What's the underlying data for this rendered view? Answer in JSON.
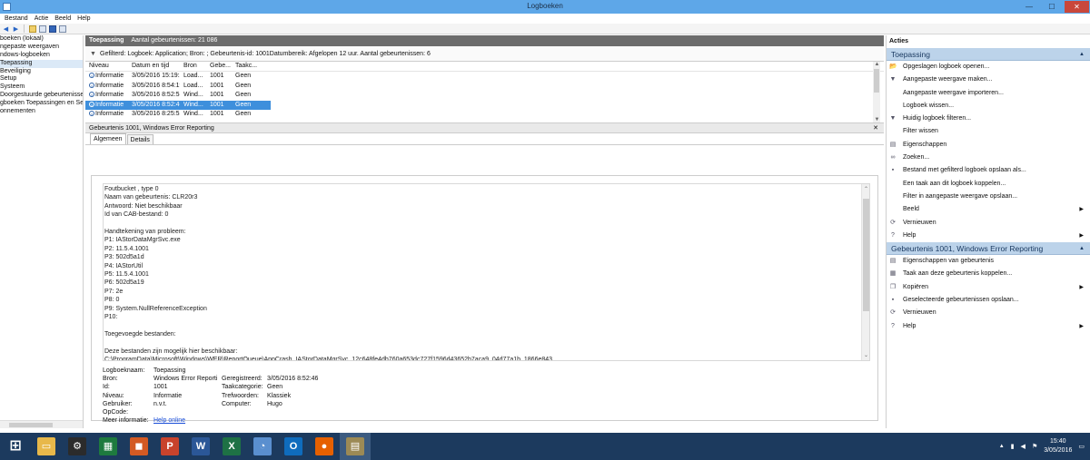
{
  "window": {
    "title": "Logboeken",
    "minimize": "—",
    "maximize": "☐",
    "close": "✕"
  },
  "menu": [
    "Bestand",
    "Actie",
    "Beeld",
    "Help"
  ],
  "tree": {
    "items": [
      {
        "label": "boeken (lokaal)",
        "selected": false
      },
      {
        "label": "ngepaste weergaven",
        "selected": false
      },
      {
        "label": "ndows-logboeken",
        "selected": false
      },
      {
        "label": "Toepassing",
        "selected": true
      },
      {
        "label": "Beveiliging",
        "selected": false
      },
      {
        "label": "Setup",
        "selected": false
      },
      {
        "label": "Systeem",
        "selected": false
      },
      {
        "label": "Doorgestuurde gebeurtenisse",
        "selected": false
      },
      {
        "label": "gboeken Toepassingen en Se",
        "selected": false
      },
      {
        "label": "onnementen",
        "selected": false
      }
    ]
  },
  "center": {
    "header_title": "Toepassing",
    "header_count": "Aantal gebeurtenissen: 21 086",
    "filter_text": "Gefilterd: Logboek: Application; Bron: ; Gebeurtenis-id: 1001Datumbereik: Afgelopen 12 uur. Aantal gebeurtenissen: 6",
    "columns": [
      "Niveau",
      "Datum en tijd",
      "Bron",
      "Gebe...",
      "Taakc..."
    ],
    "rows": [
      {
        "level": "Informatie",
        "datetime": "3/05/2016 15:19:24",
        "source": "Load...",
        "id": "1001",
        "task": "Geen",
        "selected": false
      },
      {
        "level": "Informatie",
        "datetime": "3/05/2016 8:54:19",
        "source": "Load...",
        "id": "1001",
        "task": "Geen",
        "selected": false
      },
      {
        "level": "Informatie",
        "datetime": "3/05/2016 8:52:53",
        "source": "Wind...",
        "id": "1001",
        "task": "Geen",
        "selected": false
      },
      {
        "level": "Informatie",
        "datetime": "3/05/2016 8:52:46",
        "source": "Wind...",
        "id": "1001",
        "task": "Geen",
        "selected": true
      },
      {
        "level": "Informatie",
        "datetime": "3/05/2016 8:25:52",
        "source": "Wind...",
        "id": "1001",
        "task": "Geen",
        "selected": false
      }
    ],
    "detail_title": "Gebeurtenis 1001, Windows Error Reporting",
    "tabs": [
      "Algemeen",
      "Details"
    ],
    "message_lines": [
      "Foutbucket , type 0",
      "Naam van gebeurtenis: CLR20r3",
      "Antwoord: Niet beschikbaar",
      "Id van CAB-bestand: 0",
      "",
      "Handtekening van probleem:",
      "P1: IAStorDataMgrSvc.exe",
      "P2: 11.5.4.1001",
      "P3: 502d5a1d",
      "P4: IAStorUtil",
      "P5: 11.5.4.1001",
      "P6: 502d5a19",
      "P7: 2e",
      "P8: 0",
      "P9: System.NullReferenceException",
      "P10:",
      "",
      "Toegevoegde bestanden:",
      "",
      "Deze bestanden zijn mogelijk hier beschikbaar:",
      "C:\\ProgramData\\Microsoft\\Windows\\WER\\ReportQueue\\AppCrash_IAStorDataMgrSvc_12c648fe4db760a653dc727f1596d43652b7aca9_04d77a1b_1866e843"
    ],
    "props": {
      "logname_label": "Logboeknaam:",
      "logname": "Toepassing",
      "source_label": "Bron:",
      "source": "Windows Error Reporti",
      "recorded_label": "Geregistreerd:",
      "recorded": "3/05/2016 8:52:46",
      "id_label": "Id:",
      "id": "1001",
      "taskcat_label": "Taakcategorie:",
      "taskcat": "Geen",
      "level_label": "Niveau:",
      "level": "Informatie",
      "keywords_label": "Trefwoorden:",
      "keywords": "Klassiek",
      "user_label": "Gebruiker:",
      "user": "n.v.t.",
      "computer_label": "Computer:",
      "computer": "Hugo",
      "opcode_label": "OpCode:",
      "moreinfo_label": "Meer informatie:",
      "moreinfo_link": "Help online"
    }
  },
  "actions": {
    "title": "Acties",
    "section1_title": "Toepassing",
    "section1_items": [
      {
        "label": "Opgeslagen logboek openen...",
        "icon": "folder-icon",
        "glyph": "📂",
        "submenu": false
      },
      {
        "label": "Aangepaste weergave maken...",
        "icon": "filter-icon",
        "glyph": "▼",
        "submenu": false
      },
      {
        "label": "Aangepaste weergave importeren...",
        "icon": "",
        "glyph": "",
        "submenu": false
      },
      {
        "label": "Logboek wissen...",
        "icon": "",
        "glyph": "",
        "submenu": false
      },
      {
        "label": "Huidig logboek filteren...",
        "icon": "filter-icon",
        "glyph": "▼",
        "submenu": false
      },
      {
        "label": "Filter wissen",
        "icon": "",
        "glyph": "",
        "submenu": false
      },
      {
        "label": "Eigenschappen",
        "icon": "properties-icon",
        "glyph": "▤",
        "submenu": false
      },
      {
        "label": "Zoeken...",
        "icon": "binoculars-icon",
        "glyph": "∞",
        "submenu": false
      },
      {
        "label": "Bestand met gefilterd logboek opslaan als...",
        "icon": "save-icon",
        "glyph": "▪",
        "submenu": false
      },
      {
        "label": "Een taak aan dit logboek koppelen...",
        "icon": "",
        "glyph": "",
        "submenu": false
      },
      {
        "label": "Filter in aangepaste weergave opslaan...",
        "icon": "",
        "glyph": "",
        "submenu": false
      },
      {
        "label": "Beeld",
        "icon": "",
        "glyph": "",
        "submenu": true
      },
      {
        "label": "Vernieuwen",
        "icon": "refresh-icon",
        "glyph": "⟳",
        "submenu": false
      },
      {
        "label": "Help",
        "icon": "help-icon",
        "glyph": "?",
        "submenu": true
      }
    ],
    "section2_title": "Gebeurtenis 1001, Windows Error Reporting",
    "section2_items": [
      {
        "label": "Eigenschappen van gebeurtenis",
        "icon": "properties-icon",
        "glyph": "▤",
        "submenu": false
      },
      {
        "label": "Taak aan deze gebeurtenis koppelen...",
        "icon": "task-icon",
        "glyph": "▦",
        "submenu": false
      },
      {
        "label": "Kopiëren",
        "icon": "copy-icon",
        "glyph": "❐",
        "submenu": true
      },
      {
        "label": "Geselecteerde gebeurtenissen opslaan...",
        "icon": "save-icon",
        "glyph": "▪",
        "submenu": false
      },
      {
        "label": "Vernieuwen",
        "icon": "refresh-icon",
        "glyph": "⟳",
        "submenu": false
      },
      {
        "label": "Help",
        "icon": "help-icon",
        "glyph": "?",
        "submenu": true
      }
    ]
  },
  "taskbar": {
    "apps": [
      {
        "name": "file-explorer-icon",
        "glyph": "▭",
        "color": "#e8b84a",
        "active": false
      },
      {
        "name": "control-panel-icon",
        "glyph": "⚙",
        "color": "#2b2b2b",
        "active": false
      },
      {
        "name": "excel-icon",
        "glyph": "▦",
        "color": "#1e7a3e",
        "active": false
      },
      {
        "name": "office-icon",
        "glyph": "◼",
        "color": "#d35a23",
        "active": false
      },
      {
        "name": "powerpoint-icon",
        "glyph": "P",
        "color": "#c8432c",
        "active": false
      },
      {
        "name": "word-icon",
        "glyph": "W",
        "color": "#2b5797",
        "active": false
      },
      {
        "name": "excel-icon",
        "glyph": "X",
        "color": "#1e7145",
        "active": false
      },
      {
        "name": "media-icon",
        "glyph": "◔",
        "color": "#5a8fcf",
        "active": false
      },
      {
        "name": "outlook-icon",
        "glyph": "O",
        "color": "#0f6cbd",
        "active": false
      },
      {
        "name": "firefox-icon",
        "glyph": "●",
        "color": "#e66000",
        "active": false
      },
      {
        "name": "event-viewer-icon",
        "glyph": "▤",
        "color": "#9c8a55",
        "active": true
      }
    ],
    "time": "15:40",
    "date": "3/05/2016"
  }
}
